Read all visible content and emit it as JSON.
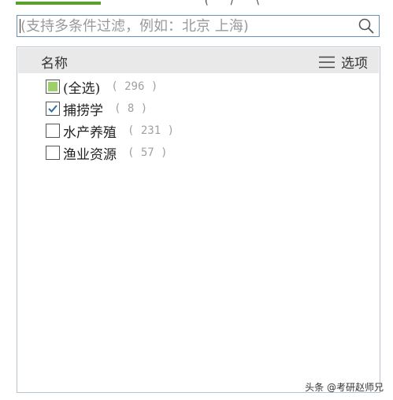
{
  "search": {
    "placeholder": "(支持多条件过滤，例如：北京 上海)"
  },
  "panel": {
    "column_title": "名称",
    "options_label": "选项",
    "items": [
      {
        "label": "(全选)",
        "count": "( 296 )",
        "state": "partial"
      },
      {
        "label": "捕捞学",
        "count": "( 8 )",
        "state": "checked"
      },
      {
        "label": "水产养殖",
        "count": "( 231 )",
        "state": "unchecked"
      },
      {
        "label": "渔业资源",
        "count": "( 57 )",
        "state": "unchecked"
      }
    ]
  },
  "watermark": "头条 @考研赵师兄",
  "colors": {
    "accent": "#5aa02c",
    "partial_fill": "#9dcf6a",
    "check": "#2e6da4"
  }
}
